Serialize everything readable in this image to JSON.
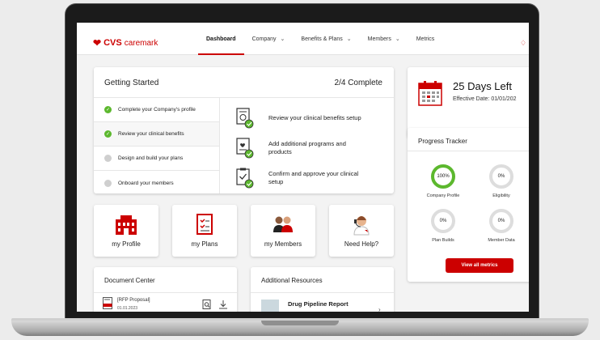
{
  "brand": {
    "logo_text": "CVS",
    "logo_sub": "caremark",
    "accent": "#cc0000",
    "success": "#5cb82e"
  },
  "nav": {
    "items": [
      {
        "label": "Dashboard",
        "active": true,
        "dropdown": false
      },
      {
        "label": "Company",
        "active": false,
        "dropdown": true
      },
      {
        "label": "Benefits & Plans",
        "active": false,
        "dropdown": true
      },
      {
        "label": "Members",
        "active": false,
        "dropdown": true
      },
      {
        "label": "Metrics",
        "active": false,
        "dropdown": false
      }
    ],
    "notification_icon": "bell-icon"
  },
  "getting_started": {
    "title": "Getting Started",
    "progress": "2/4 Complete",
    "steps": [
      {
        "label": "Complete your Company's profile",
        "done": true
      },
      {
        "label": "Review your clinical benefits",
        "done": true
      },
      {
        "label": "Design and build your plans",
        "done": false
      },
      {
        "label": "Onboard your members",
        "done": false
      }
    ],
    "tasks": [
      {
        "label": "Review your clinical benefits setup",
        "icon": "report-icon"
      },
      {
        "label": "Add additional programs and products",
        "icon": "receipt-heart-icon"
      },
      {
        "label": "Confirm and approve your clinical setup",
        "icon": "clipboard-check-icon"
      }
    ]
  },
  "days_left": {
    "title": "25 Days Left",
    "effective": "Effective Date: 01/01/202"
  },
  "progress_tracker": {
    "title": "Progress Tracker",
    "items": [
      {
        "value": "100%",
        "label": "Company Profile",
        "percent": 100
      },
      {
        "value": "0%",
        "label": "Eligibility",
        "percent": 0
      },
      {
        "value": "0%",
        "label": "Plan Builds",
        "percent": 0
      },
      {
        "value": "0%",
        "label": "Member Data",
        "percent": 0
      }
    ],
    "button": "View all metrics"
  },
  "tiles": [
    {
      "label": "my Profile",
      "icon": "building-icon"
    },
    {
      "label": "my Plans",
      "icon": "checklist-icon"
    },
    {
      "label": "my Members",
      "icon": "people-icon"
    },
    {
      "label": "Need Help?",
      "icon": "support-agent-icon"
    }
  ],
  "document_center": {
    "title": "Document Center",
    "file": {
      "name": "[RFP Proposal]",
      "date": "01.01.2023"
    }
  },
  "additional_resources": {
    "title": "Additional Resources",
    "item": "Drug Pipeline Report"
  }
}
